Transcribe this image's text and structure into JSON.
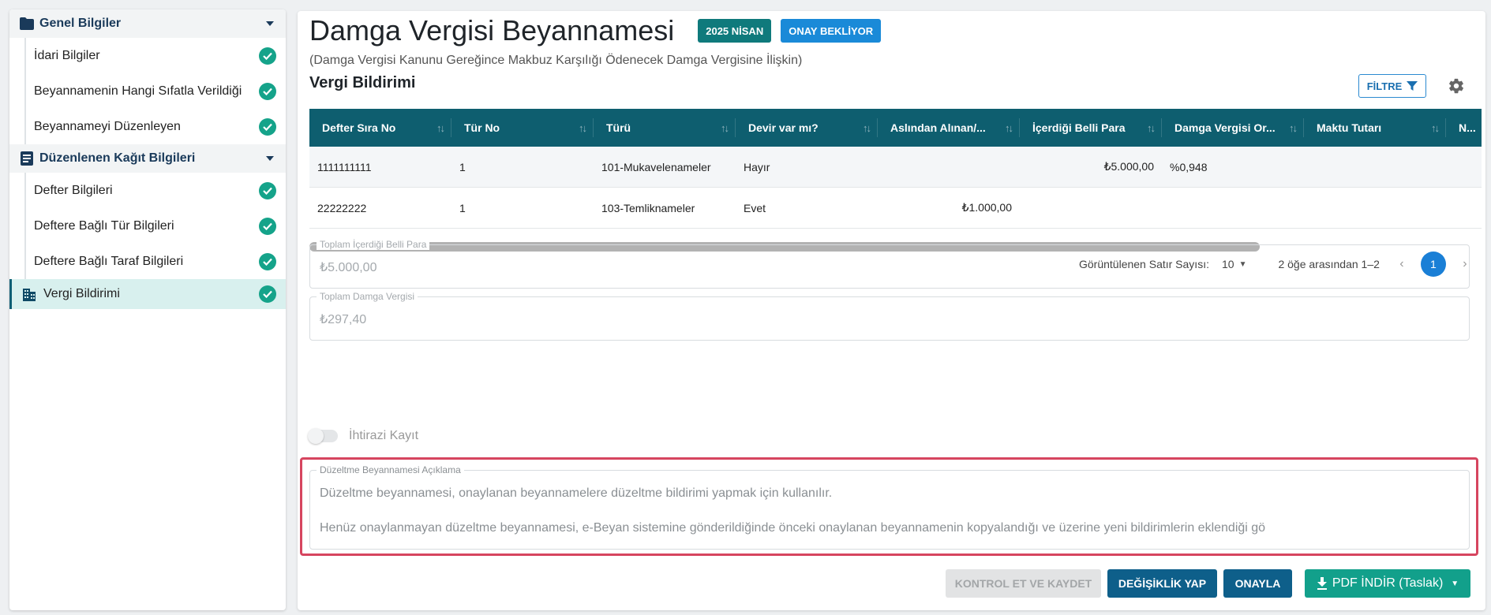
{
  "colors": {
    "brand_teal": "#0e5e6f",
    "accent_green": "#15a38a",
    "accent_blue": "#1a8ad8",
    "highlight_red": "#d6455f"
  },
  "sidebar": {
    "sections": [
      {
        "title": "Genel Bilgiler",
        "icon": "folder-icon",
        "items": [
          {
            "label": "İdari Bilgiler",
            "status_icon": "check-circle-icon"
          },
          {
            "label": "Beyannamenin Hangi Sıfatla Verildiği",
            "status_icon": "check-circle-icon"
          },
          {
            "label": "Beyannameyi Düzenleyen",
            "status_icon": "check-circle-icon"
          }
        ]
      },
      {
        "title": "Düzenlenen Kağıt Bilgileri",
        "icon": "document-icon",
        "items": [
          {
            "label": "Defter Bilgileri",
            "status_icon": "check-circle-icon"
          },
          {
            "label": "Deftere Bağlı Tür Bilgileri",
            "status_icon": "check-circle-icon"
          },
          {
            "label": "Deftere Bağlı Taraf Bilgileri",
            "status_icon": "check-circle-icon"
          }
        ]
      }
    ],
    "active_item": {
      "label": "Vergi Bildirimi",
      "icon": "building-icon",
      "status_icon": "check-circle-icon"
    }
  },
  "header": {
    "title": "Damga Vergisi Beyannamesi",
    "period_badge": "2025 NİSAN",
    "status_badge": "ONAY BEKLİYOR",
    "subtitle": "(Damga Vergisi Kanunu Gereğince Makbuz Karşılığı Ödenecek Damga Vergisine İlişkin)"
  },
  "section": {
    "title": "Vergi Bildirimi",
    "filter_label": "FİLTRE"
  },
  "table": {
    "columns": [
      "Defter Sıra No",
      "Tür No",
      "Türü",
      "Devir var mı?",
      "Aslından Alınan/...",
      "İçerdiği Belli Para",
      "Damga Vergisi Or...",
      "Maktu Tutarı",
      "N..."
    ],
    "rows": [
      [
        "1111111111",
        "1",
        "101-Mukavelenameler",
        "Hayır",
        "",
        "₺5.000,00",
        "%0,948",
        "",
        ""
      ],
      [
        "22222222",
        "1",
        "103-Temliknameler",
        "Evet",
        "₺1.000,00",
        "",
        "",
        "",
        ""
      ]
    ]
  },
  "pagination": {
    "rows_label": "Görüntülenen Satır Sayısı:",
    "rows_value": "10",
    "range": "2 öğe arasından 1–2",
    "prev": "‹",
    "current_page": "1",
    "next": "›"
  },
  "fields": {
    "total_amount": {
      "label": "Toplam İçerdiği Belli Para",
      "value": "₺5.000,00"
    },
    "total_tax": {
      "label": "Toplam Damga Vergisi",
      "value": "₺297,40"
    }
  },
  "toggle": {
    "label": "İhtirazi Kayıt",
    "checked": false
  },
  "correction": {
    "label": "Düzeltme Beyannamesi Açıklama",
    "line1": "Düzeltme beyannamesi, onaylanan beyannamelere düzeltme bildirimi yapmak için kullanılır.",
    "line2": "Henüz onaylanmayan düzeltme beyannamesi, e-Beyan sistemine gönderildiğinde önceki onaylanan beyannamenin kopyalandığı ve üzerine yeni bildirimlerin eklendiği gö"
  },
  "actions": {
    "check_save": "KONTROL ET VE KAYDET",
    "make_change": "DEĞİŞİKLİK YAP",
    "approve": "ONAYLA",
    "pdf": "PDF İNDİR (Taslak)"
  }
}
